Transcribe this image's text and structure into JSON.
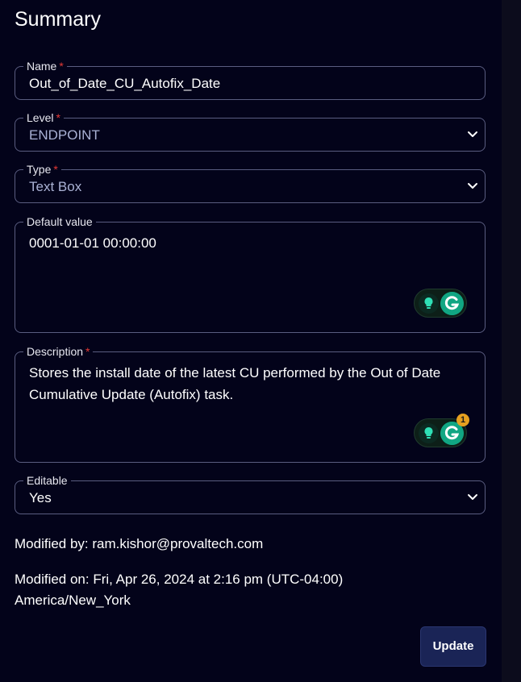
{
  "title": "Summary",
  "fields": {
    "name": {
      "label": "Name",
      "required_mark": "*",
      "value": "Out_of_Date_CU_Autofix_Date"
    },
    "level": {
      "label": "Level",
      "required_mark": "*",
      "value": "ENDPOINT"
    },
    "type": {
      "label": "Type",
      "required_mark": "*",
      "value": "Text Box"
    },
    "default_value": {
      "label": "Default value",
      "value": "0001-01-01 00:00:00"
    },
    "description": {
      "label": "Description",
      "required_mark": "*",
      "value": "Stores the install date of the latest CU performed by the Out of Date Cumulative Update (Autofix) task.",
      "grammarly_badge": "1"
    },
    "editable": {
      "label": "Editable",
      "value": "Yes"
    }
  },
  "meta": {
    "modified_by": "Modified by: ram.kishor@provaltech.com",
    "modified_on_line1": "Modified on: Fri, Apr 26, 2024 at 2:16 pm (UTC-04:00)",
    "modified_on_line2": "America/New_York"
  },
  "actions": {
    "update_label": "Update"
  },
  "icons": {
    "chevron": "chevron-down-icon",
    "bulb": "lightbulb-icon",
    "grammarly": "grammarly-icon"
  },
  "colors": {
    "background": "#03031a",
    "required": "#e53935",
    "muted_value": "#aab2d4",
    "button": "#1a2456",
    "grammarly": "#11a683",
    "badge": "#e6a020"
  }
}
